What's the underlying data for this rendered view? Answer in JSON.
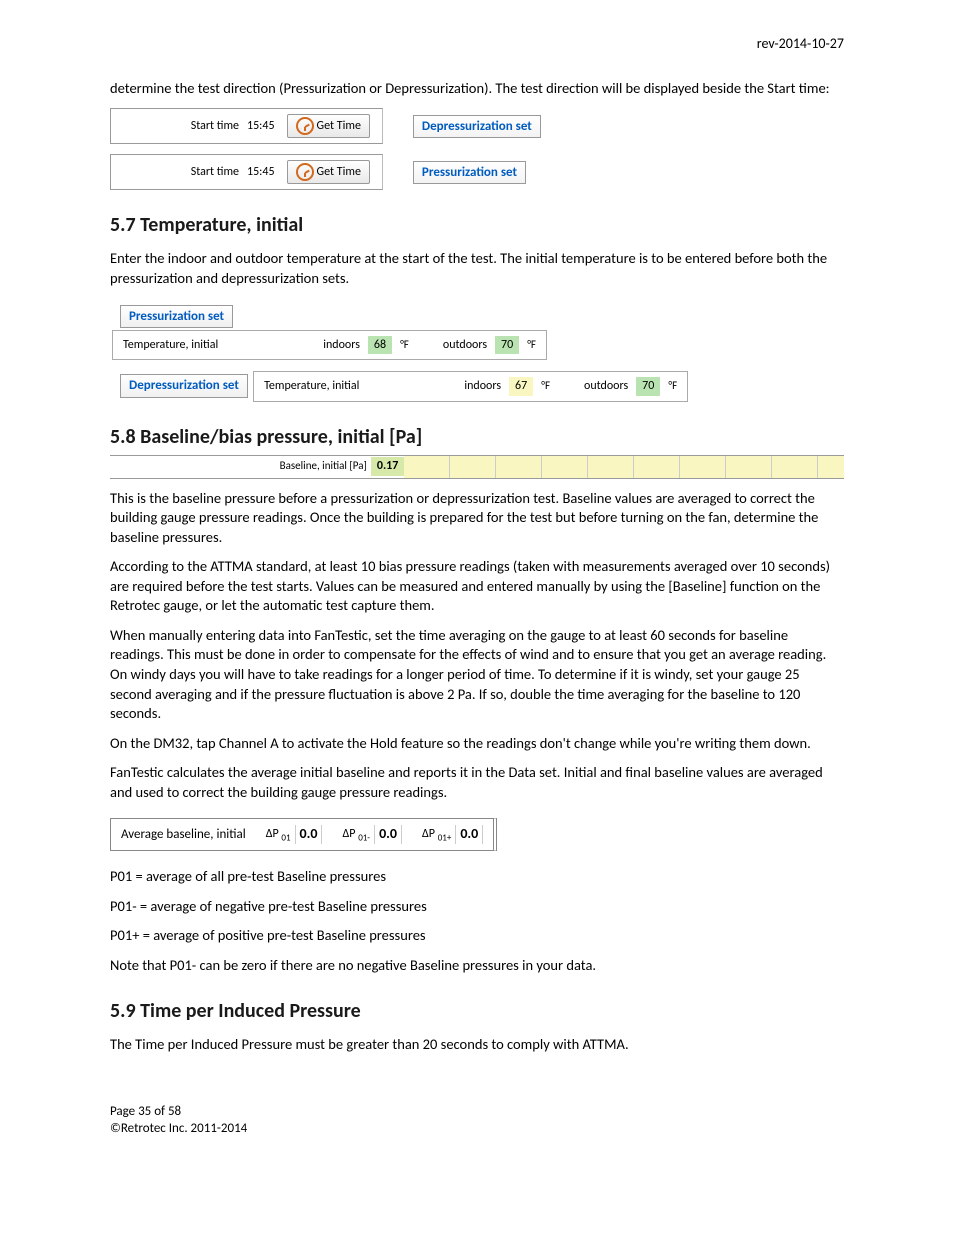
{
  "rev": "rev-2014-10-27",
  "intro": "determine the test direction (Pressurization or Depressurization).  The test direction will be displayed beside the Start time:",
  "startRows": [
    {
      "label": "Start time",
      "time": "15:45",
      "btn": "Get Time",
      "state": "Depressurization set"
    },
    {
      "label": "Start time",
      "time": "15:45",
      "btn": "Get Time",
      "state": "Pressurization set"
    }
  ],
  "h57": "5.7  Temperature, initial",
  "p57": "Enter the indoor and outdoor temperature at the start of the test. The initial temperature is to be entered before both the pressurization and depressurization sets.",
  "tempSets": [
    {
      "set": "Pressurization set",
      "title": "Temperature, initial",
      "indoorsLbl": "indoors",
      "indoors": "68",
      "unit": "°F",
      "outdoorsLbl": "outdoors",
      "outdoors": "70"
    },
    {
      "set": "Depressurization set",
      "title": "Temperature, initial",
      "indoorsLbl": "indoors",
      "indoors": "67",
      "unit": "°F",
      "outdoorsLbl": "outdoors",
      "outdoors": "70"
    }
  ],
  "h58": "5.8  Baseline/bias pressure, initial [Pa]",
  "baseline": {
    "label": "Baseline, initial [Pa]",
    "value": "0.17"
  },
  "p58a": "This is the baseline pressure before a pressurization or depressurization test.  Baseline values are averaged to correct the building gauge pressure readings.  Once the building is prepared for the test but before turning on the fan, determine the baseline pressures.",
  "p58b": "According to the ATTMA standard, at least 10 bias pressure readings (taken with measurements averaged over 10 seconds) are required before the test starts.  Values can be measured and entered manually by using the [Baseline] function on the Retrotec gauge, or let the automatic test capture them.",
  "p58c": "When manually entering data into FanTestic, set the time averaging on the gauge to at least 60 seconds for baseline readings.  This must be done in order to compensate for the effects of wind and to ensure that you get an average reading.  On windy days you will have to take readings for a longer period of time.  To determine if it is windy, set your gauge 25 second averaging and if the pressure fluctuation is above 2 Pa.  If so, double the time averaging for the baseline to 120 seconds.",
  "p58d": "On the DM32, tap Channel A to activate the Hold feature so the readings don't change while you're writing them down.",
  "p58e": "FanTestic calculates the average initial baseline and reports it in the Data set.  Initial and final baseline values are averaged and used to correct the building gauge pressure readings.",
  "avg": {
    "title": "Average baseline, initial",
    "items": [
      {
        "lbl": "ΔP",
        "sub": "01",
        "val": "0.0"
      },
      {
        "lbl": "ΔP",
        "sub": "01-",
        "val": "0.0"
      },
      {
        "lbl": "ΔP",
        "sub": "01+",
        "val": "0.0"
      }
    ]
  },
  "defs": [
    "P01 = average of all pre-test Baseline pressures",
    "P01- = average of negative pre-test Baseline pressures",
    "P01+ = average of positive pre-test Baseline pressures",
    "Note that P01- can be zero if there are no negative Baseline pressures in your data."
  ],
  "h59": "5.9  Time per Induced Pressure",
  "p59": "The Time per Induced Pressure must be greater than 20 seconds to comply with ATTMA.",
  "footer1": "Page 35 of 58",
  "footer2": "©Retrotec Inc. 2011-2014"
}
